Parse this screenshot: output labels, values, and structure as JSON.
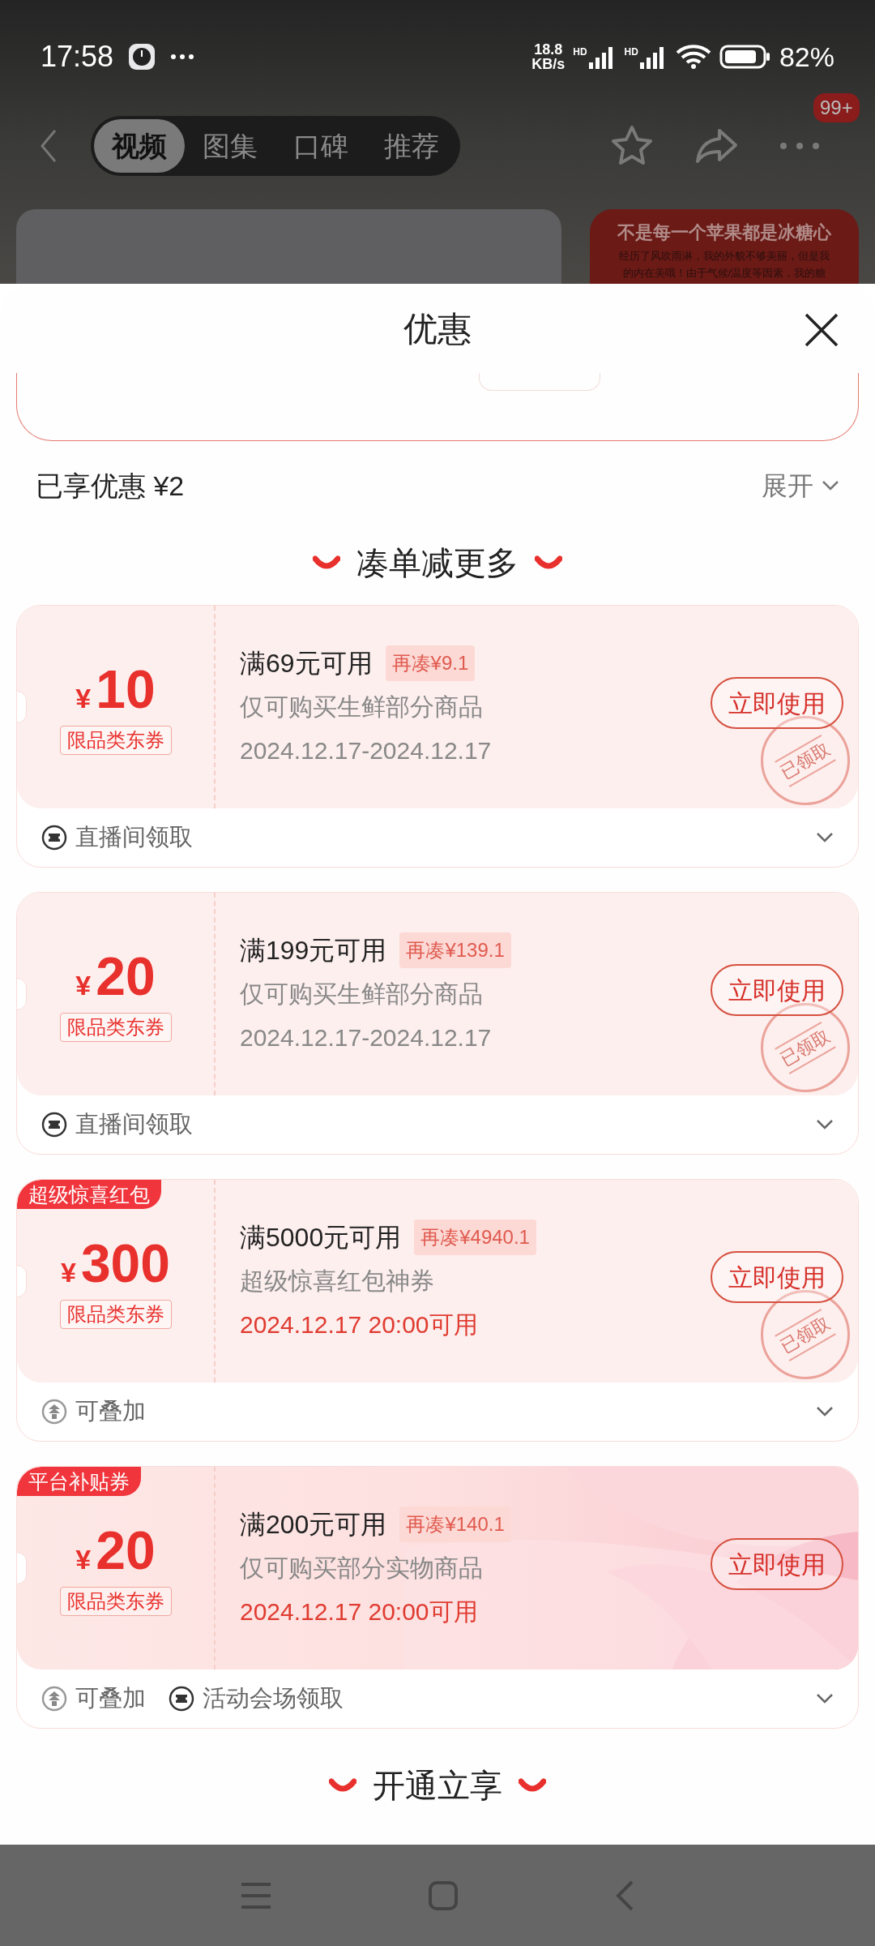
{
  "status_bar": {
    "time": "17:58",
    "speed_value": "18.8",
    "speed_unit": "KB/s",
    "sim_labels": [
      "HD",
      "HD"
    ],
    "battery_text": "82%"
  },
  "nav": {
    "tabs": [
      {
        "label": "视频",
        "selected": true
      },
      {
        "label": "图集",
        "selected": false
      },
      {
        "label": "口碑",
        "selected": false
      },
      {
        "label": "推荐",
        "selected": false
      }
    ],
    "badge": "99+"
  },
  "background_card": {
    "title": "不是每一个苹果都是冰糖心",
    "lines": [
      "经历了风吹雨淋，我的外貌不够美丽，但是我",
      "的内在美哦！由于气候/温度等因素，我的糖"
    ]
  },
  "sheet": {
    "title": "优惠",
    "enjoyed": "已享优惠 ¥2",
    "expand": "展开",
    "sections": [
      {
        "title": "凑单减更多",
        "coupons": [
          {
            "kind": "plain",
            "currency": "¥",
            "amount": "10",
            "type_tag": "限品类东券",
            "title": "满69元可用",
            "gap": "再凑¥9.1",
            "desc": "仅可购买生鲜部分商品",
            "validity": "2024.12.17-2024.12.17",
            "validity_highlight": false,
            "button": "立即使用",
            "stamp": "已领取",
            "footer": [
              {
                "kind": "source",
                "text": "直播间领取"
              }
            ]
          },
          {
            "kind": "plain",
            "currency": "¥",
            "amount": "20",
            "type_tag": "限品类东券",
            "title": "满199元可用",
            "gap": "再凑¥139.1",
            "desc": "仅可购买生鲜部分商品",
            "validity": "2024.12.17-2024.12.17",
            "validity_highlight": false,
            "button": "立即使用",
            "stamp": "已领取",
            "footer": [
              {
                "kind": "source",
                "text": "直播间领取"
              }
            ]
          },
          {
            "kind": "plain",
            "corner_tag": "超级惊喜红包",
            "currency": "¥",
            "amount": "300",
            "type_tag": "限品类东券",
            "title": "满5000元可用",
            "gap": "再凑¥4940.1",
            "desc": "超级惊喜红包神券",
            "validity": "2024.12.17 20:00可用",
            "validity_highlight": true,
            "button": "立即使用",
            "stamp": "已领取",
            "footer": [
              {
                "kind": "stackable",
                "text": "可叠加"
              }
            ]
          },
          {
            "kind": "promo",
            "corner_tag": "平台补贴券",
            "currency": "¥",
            "amount": "20",
            "type_tag": "限品类东券",
            "title": "满200元可用",
            "gap": "再凑¥140.1",
            "desc": "仅可购买部分实物商品",
            "validity": "2024.12.17 20:00可用",
            "validity_highlight": true,
            "button": "立即使用",
            "footer": [
              {
                "kind": "stackable",
                "text": "可叠加"
              },
              {
                "kind": "source",
                "text": "活动会场领取"
              }
            ]
          }
        ]
      },
      {
        "title": "开通立享"
      }
    ]
  }
}
